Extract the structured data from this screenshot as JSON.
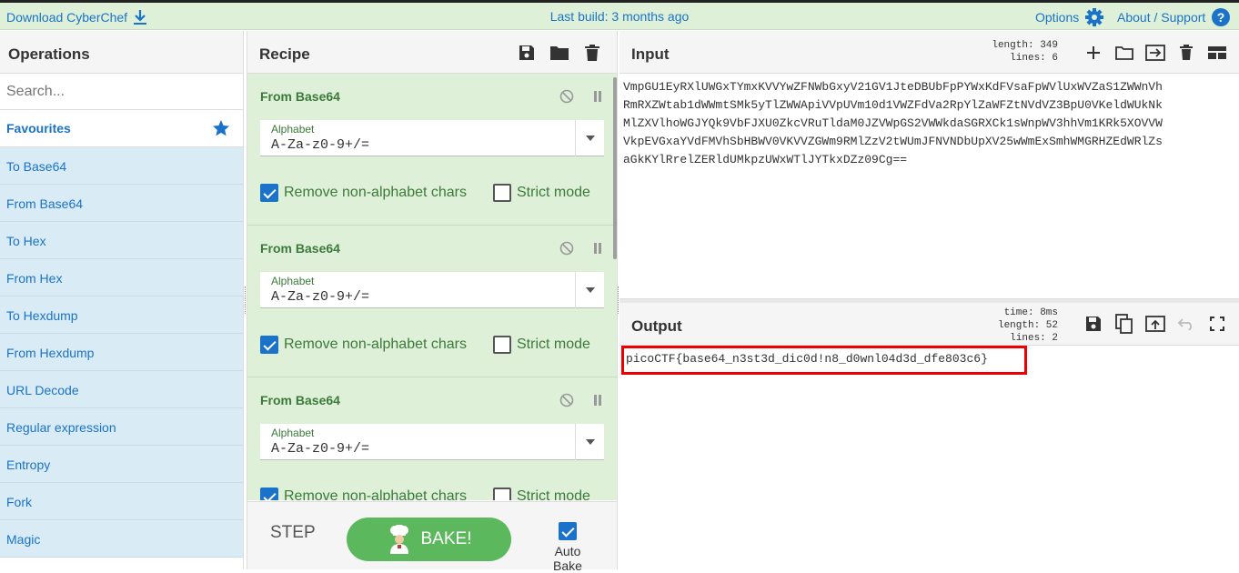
{
  "banner": {
    "download_label": "Download CyberChef",
    "build_label": "Last build: 3 months ago",
    "options_label": "Options",
    "about_label": "About / Support"
  },
  "operations": {
    "title": "Operations",
    "search_placeholder": "Search...",
    "favourites_label": "Favourites",
    "items": [
      "To Base64",
      "From Base64",
      "To Hex",
      "From Hex",
      "To Hexdump",
      "From Hexdump",
      "URL Decode",
      "Regular expression",
      "Entropy",
      "Fork",
      "Magic"
    ]
  },
  "recipe": {
    "title": "Recipe",
    "ops": [
      {
        "name": "From Base64",
        "alphabet_label": "Alphabet",
        "alphabet_value": "A-Za-z0-9+/=",
        "remove_label": "Remove non-alphabet chars",
        "remove_checked": true,
        "strict_label": "Strict mode",
        "strict_checked": false
      },
      {
        "name": "From Base64",
        "alphabet_label": "Alphabet",
        "alphabet_value": "A-Za-z0-9+/=",
        "remove_label": "Remove non-alphabet chars",
        "remove_checked": true,
        "strict_label": "Strict mode",
        "strict_checked": false
      },
      {
        "name": "From Base64",
        "alphabet_label": "Alphabet",
        "alphabet_value": "A-Za-z0-9+/=",
        "remove_label": "Remove non-alphabet chars",
        "remove_checked": true,
        "strict_label": "Strict mode",
        "strict_checked": false
      }
    ],
    "step_label": "STEP",
    "bake_label": "BAKE!",
    "autobake_label": "Auto Bake",
    "autobake_checked": true
  },
  "input": {
    "title": "Input",
    "length_label": "length:",
    "length": "349",
    "lines_label": "lines:",
    "lines": "6",
    "text": "VmpGU1EyRXlUWGxTYmxKVVYwZFNWbGxyV21GV1JteDBUbFpPYWxKdFVsaFpWVlUxWVZaS1ZWWnVh\nRmRXZWtab1dWWmtSMk5yTlZWWApiVVpUVm10d1VWZFdVa2RpYlZaWFZtNVdVZ3BpU0VKeldWUkNk\nMlZXVlhoWGJYQk9VbFJXU0ZkcVRuTldaM0JZVWpGS2VWWkdaSGRXCk1sWnpWV3hhVm1KRk5XOVVW\nVkpEVGxaYVdFMVhSbHBWV0VKVVZGWm9RMlZzV2tWUmJFNVNDbUpXV25wWmExSmhWMGRHZEdWRlZs\naGkKYlRrelZERldUMkpzUWxWTlJYTkxDZz09Cg=="
  },
  "output": {
    "title": "Output",
    "time_label": "time:",
    "time": "8ms",
    "length_label": "length:",
    "length": "52",
    "lines_label": "lines:",
    "lines": "2",
    "text": "picoCTF{base64_n3st3d_dic0d!n8_d0wnl04d3d_dfe803c6}"
  },
  "colors": {
    "accent": "#1a73c9",
    "banner_bg": "#dff0d8",
    "recipe_bg": "#dff0d8",
    "op_list_bg": "#d9ebf5",
    "bake_button": "#5cb85c",
    "highlight_box": "#e00000"
  }
}
